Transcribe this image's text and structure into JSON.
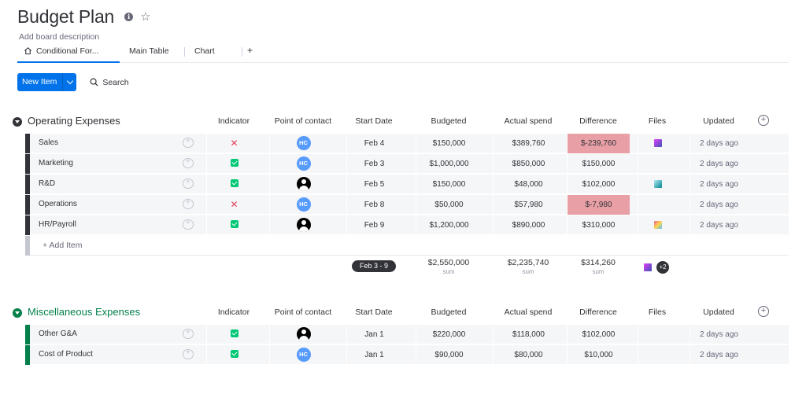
{
  "board": {
    "title": "Budget Plan",
    "description": "Add board description"
  },
  "tabs": [
    {
      "label": "Conditional For...",
      "active": true
    },
    {
      "label": "Main Table"
    },
    {
      "label": "Chart"
    },
    {
      "label": "+"
    }
  ],
  "toolbar": {
    "new_item_label": "New Item",
    "search_label": "Search"
  },
  "columns": [
    "Indicator",
    "Point of contact",
    "Start Date",
    "Budgeted",
    "Actual spend",
    "Difference",
    "Files",
    "Updated"
  ],
  "groups": [
    {
      "title": "Operating Expenses",
      "color": "#323338",
      "rows": [
        {
          "name": "Sales",
          "indicator": "x",
          "contact": "HC",
          "start_date": "Feb 4",
          "budgeted": "$150,000",
          "actual": "$389,760",
          "difference": "$-239,760",
          "diff_negative": true,
          "file": "purple",
          "updated": "2 days ago"
        },
        {
          "name": "Marketing",
          "indicator": "check",
          "contact": "HC",
          "start_date": "Feb 3",
          "budgeted": "$1,000,000",
          "actual": "$850,000",
          "difference": "$150,000",
          "diff_negative": false,
          "file": "",
          "updated": "2 days ago"
        },
        {
          "name": "R&D",
          "indicator": "check",
          "contact": "user",
          "start_date": "Feb 5",
          "budgeted": "$150,000",
          "actual": "$48,000",
          "difference": "$102,000",
          "diff_negative": false,
          "file": "teal",
          "updated": "2 days ago"
        },
        {
          "name": "Operations",
          "indicator": "x",
          "contact": "HC",
          "start_date": "Feb 8",
          "budgeted": "$50,000",
          "actual": "$57,980",
          "difference": "$-7,980",
          "diff_negative": true,
          "file": "",
          "updated": "2 days ago"
        },
        {
          "name": "HR/Payroll",
          "indicator": "check",
          "contact": "user",
          "start_date": "Feb 9",
          "budgeted": "$1,200,000",
          "actual": "$890,000",
          "difference": "$310,000",
          "diff_negative": false,
          "file": "rainbow",
          "updated": "2 days ago"
        }
      ],
      "add_item_label": "+ Add Item",
      "summary": {
        "date_range": "Feb 3 - 9",
        "budgeted": "$2,550,000",
        "actual": "$2,235,740",
        "difference": "$314,260",
        "sum_label": "sum",
        "files_more": "+2"
      }
    },
    {
      "title": "Miscellaneous Expenses",
      "color": "#037f4c",
      "rows": [
        {
          "name": "Other G&A",
          "indicator": "check",
          "contact": "user",
          "start_date": "Jan 1",
          "budgeted": "$220,000",
          "actual": "$118,000",
          "difference": "$102,000",
          "diff_negative": false,
          "file": "",
          "updated": "2 days ago"
        },
        {
          "name": "Cost of Product",
          "indicator": "check",
          "contact": "HC",
          "start_date": "Jan 1",
          "budgeted": "$90,000",
          "actual": "$80,000",
          "difference": "$10,000",
          "diff_negative": false,
          "file": "",
          "updated": "2 days ago"
        }
      ]
    }
  ],
  "colors": {
    "accent": "#0073ea",
    "negative_cell": "#e8a0a6",
    "check": "#00c875",
    "x_mark": "#e2445c",
    "group1_bar": "#323338",
    "group2_bar": "#037f4c"
  }
}
